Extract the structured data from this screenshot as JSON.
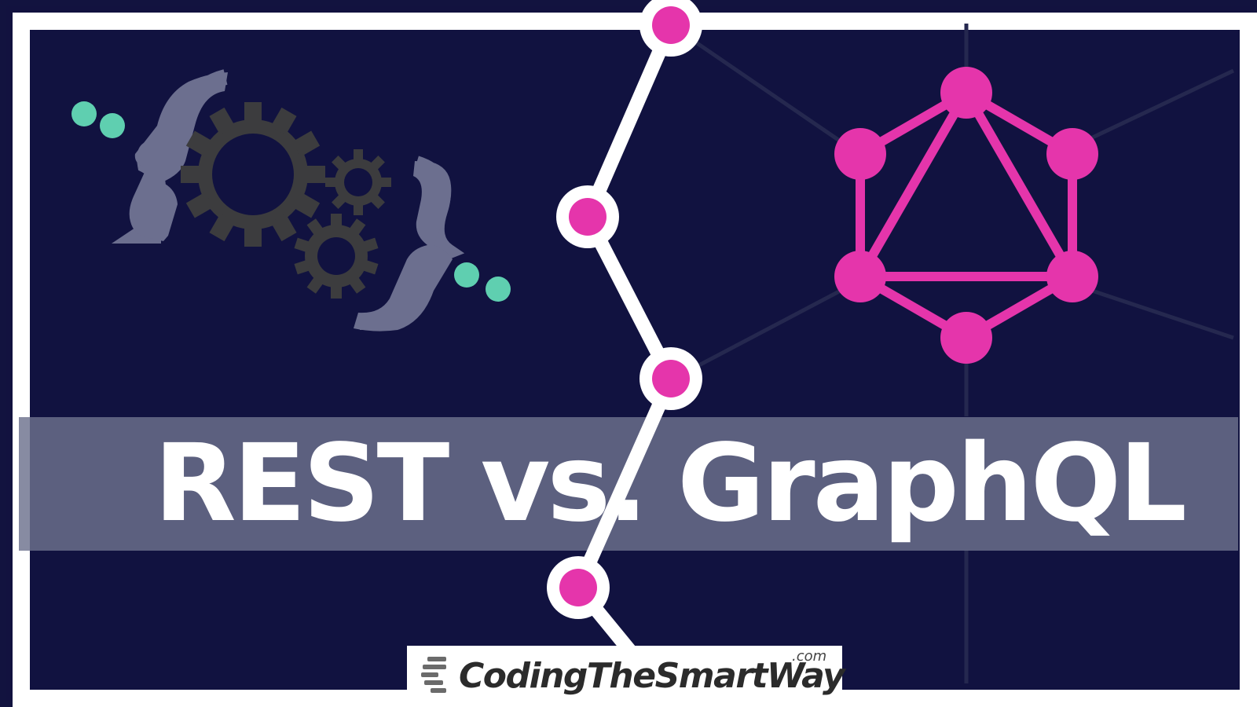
{
  "title": {
    "left": "REST vs.",
    "right": "GraphQL"
  },
  "logo": {
    "name": "CodingTheSmartWay",
    "suffix": ".com"
  },
  "colors": {
    "background": "#111240",
    "band": "#6c718e",
    "accent_pink": "#e535ab",
    "accent_teal": "#5fcfb0",
    "gear": "#3c3c3e",
    "brace": "#6c6f8f",
    "white": "#ffffff"
  },
  "icons": {
    "left": "gears-with-braces-icon",
    "right": "graphql-logo-icon",
    "divider": "timeline-path-icon",
    "brand": "codingthesmartway-logo-icon"
  }
}
